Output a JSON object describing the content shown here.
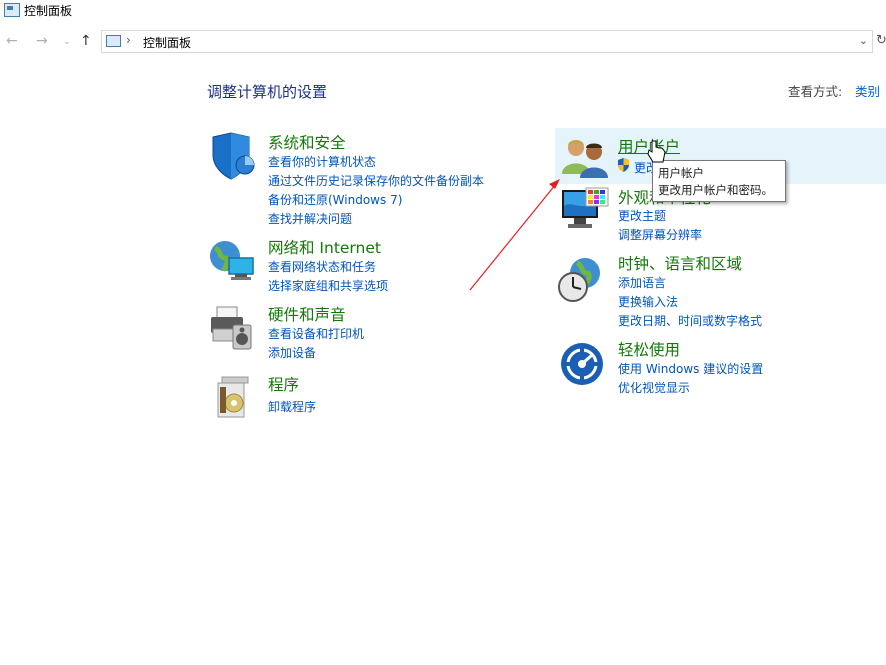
{
  "window": {
    "title": "控制面板"
  },
  "address": {
    "crumb": "控制面板"
  },
  "nav": {
    "back_icon": "←",
    "forward_icon": "→",
    "recent_icon": "⌄",
    "up_icon": "↑",
    "separator": "›",
    "dropdown_icon": "⌄",
    "refresh_icon": "↻"
  },
  "main": {
    "heading": "调整计算机的设置",
    "view_by_label": "查看方式:",
    "view_by_value": "类别"
  },
  "categories": {
    "security": {
      "title": "系统和安全",
      "links": [
        "查看你的计算机状态",
        "通过文件历史记录保存你的文件备份副本",
        "备份和还原(Windows 7)",
        "查找并解决问题"
      ]
    },
    "network": {
      "title": "网络和 Internet",
      "links": [
        "查看网络状态和任务",
        "选择家庭组和共享选项"
      ]
    },
    "hardware": {
      "title": "硬件和声音",
      "links": [
        "查看设备和打印机",
        "添加设备"
      ]
    },
    "programs": {
      "title": "程序",
      "links": [
        "卸载程序"
      ]
    },
    "accounts": {
      "title": "用户帐户",
      "links": [
        "更改帐户类型"
      ]
    },
    "appearance": {
      "title": "外观和个性化",
      "links": [
        "更改主题",
        "调整屏幕分辨率"
      ]
    },
    "clock": {
      "title": "时钟、语言和区域",
      "links": [
        "添加语言",
        "更换输入法",
        "更改日期、时间或数字格式"
      ]
    },
    "ease": {
      "title": "轻松使用",
      "links": [
        "使用 Windows 建议的设置",
        "优化视觉显示"
      ]
    }
  },
  "tooltip": {
    "line1": "用户帐户",
    "line2": "更改用户帐户和密码。"
  },
  "colors": {
    "title_green": "#14780a",
    "link_blue": "#0055bb",
    "heading_blue": "#1e3287",
    "hover_bg": "#e5f3fb",
    "arrow_red": "#e02020"
  }
}
